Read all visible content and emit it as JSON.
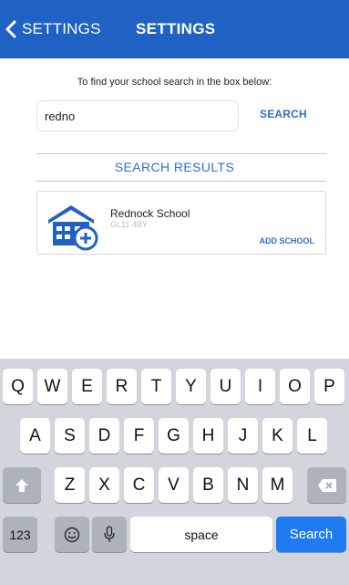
{
  "nav": {
    "back_label": "SETTINGS",
    "title": "SETTINGS",
    "bar_color": "#1f62c4"
  },
  "search": {
    "instructions": "To find your school search in the box below:",
    "query": "redno",
    "button_label": "SEARCH"
  },
  "results": {
    "heading": "SEARCH RESULTS",
    "items": [
      {
        "name": "Rednock School",
        "postcode": "GL11 4BY",
        "action_label": "ADD SCHOOL",
        "icon": "school-add-icon"
      }
    ]
  },
  "keyboard": {
    "row1": [
      "Q",
      "W",
      "E",
      "R",
      "T",
      "Y",
      "U",
      "I",
      "O",
      "P"
    ],
    "row2": [
      "A",
      "S",
      "D",
      "F",
      "G",
      "H",
      "J",
      "K",
      "L"
    ],
    "row3": [
      "Z",
      "X",
      "C",
      "V",
      "B",
      "N",
      "M"
    ],
    "numbers_label": "123",
    "space_label": "space",
    "return_label": "Search",
    "shift_icon": "shift-icon",
    "delete_icon": "delete-icon",
    "emoji_icon": "emoji-icon",
    "mic_icon": "microphone-icon"
  },
  "colors": {
    "accent": "#2f6fd0",
    "keyboard_bg": "#d2d5db",
    "search_key": "#1e7cf0"
  }
}
